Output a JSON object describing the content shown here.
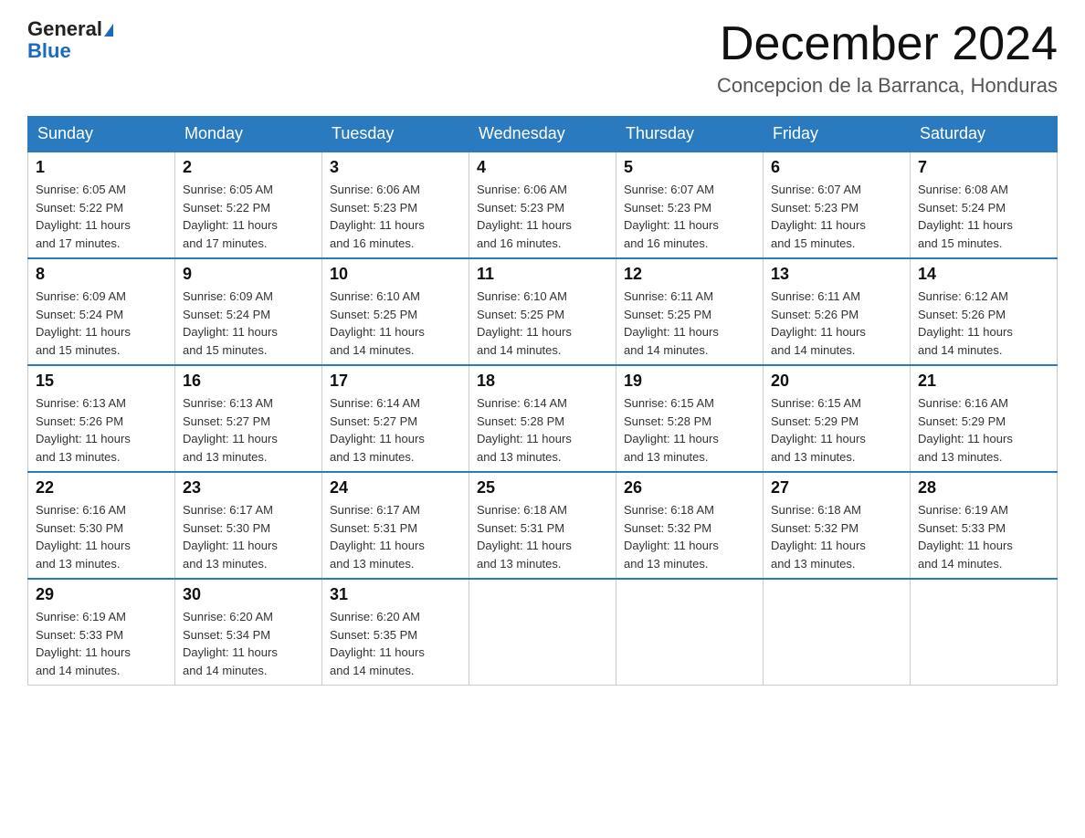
{
  "header": {
    "logo_general": "General",
    "logo_blue": "Blue",
    "month_title": "December 2024",
    "location": "Concepcion de la Barranca, Honduras"
  },
  "days_of_week": [
    "Sunday",
    "Monday",
    "Tuesday",
    "Wednesday",
    "Thursday",
    "Friday",
    "Saturday"
  ],
  "weeks": [
    [
      {
        "day": "1",
        "sunrise": "6:05 AM",
        "sunset": "5:22 PM",
        "daylight": "11 hours and 17 minutes."
      },
      {
        "day": "2",
        "sunrise": "6:05 AM",
        "sunset": "5:22 PM",
        "daylight": "11 hours and 17 minutes."
      },
      {
        "day": "3",
        "sunrise": "6:06 AM",
        "sunset": "5:23 PM",
        "daylight": "11 hours and 16 minutes."
      },
      {
        "day": "4",
        "sunrise": "6:06 AM",
        "sunset": "5:23 PM",
        "daylight": "11 hours and 16 minutes."
      },
      {
        "day": "5",
        "sunrise": "6:07 AM",
        "sunset": "5:23 PM",
        "daylight": "11 hours and 16 minutes."
      },
      {
        "day": "6",
        "sunrise": "6:07 AM",
        "sunset": "5:23 PM",
        "daylight": "11 hours and 15 minutes."
      },
      {
        "day": "7",
        "sunrise": "6:08 AM",
        "sunset": "5:24 PM",
        "daylight": "11 hours and 15 minutes."
      }
    ],
    [
      {
        "day": "8",
        "sunrise": "6:09 AM",
        "sunset": "5:24 PM",
        "daylight": "11 hours and 15 minutes."
      },
      {
        "day": "9",
        "sunrise": "6:09 AM",
        "sunset": "5:24 PM",
        "daylight": "11 hours and 15 minutes."
      },
      {
        "day": "10",
        "sunrise": "6:10 AM",
        "sunset": "5:25 PM",
        "daylight": "11 hours and 14 minutes."
      },
      {
        "day": "11",
        "sunrise": "6:10 AM",
        "sunset": "5:25 PM",
        "daylight": "11 hours and 14 minutes."
      },
      {
        "day": "12",
        "sunrise": "6:11 AM",
        "sunset": "5:25 PM",
        "daylight": "11 hours and 14 minutes."
      },
      {
        "day": "13",
        "sunrise": "6:11 AM",
        "sunset": "5:26 PM",
        "daylight": "11 hours and 14 minutes."
      },
      {
        "day": "14",
        "sunrise": "6:12 AM",
        "sunset": "5:26 PM",
        "daylight": "11 hours and 14 minutes."
      }
    ],
    [
      {
        "day": "15",
        "sunrise": "6:13 AM",
        "sunset": "5:26 PM",
        "daylight": "11 hours and 13 minutes."
      },
      {
        "day": "16",
        "sunrise": "6:13 AM",
        "sunset": "5:27 PM",
        "daylight": "11 hours and 13 minutes."
      },
      {
        "day": "17",
        "sunrise": "6:14 AM",
        "sunset": "5:27 PM",
        "daylight": "11 hours and 13 minutes."
      },
      {
        "day": "18",
        "sunrise": "6:14 AM",
        "sunset": "5:28 PM",
        "daylight": "11 hours and 13 minutes."
      },
      {
        "day": "19",
        "sunrise": "6:15 AM",
        "sunset": "5:28 PM",
        "daylight": "11 hours and 13 minutes."
      },
      {
        "day": "20",
        "sunrise": "6:15 AM",
        "sunset": "5:29 PM",
        "daylight": "11 hours and 13 minutes."
      },
      {
        "day": "21",
        "sunrise": "6:16 AM",
        "sunset": "5:29 PM",
        "daylight": "11 hours and 13 minutes."
      }
    ],
    [
      {
        "day": "22",
        "sunrise": "6:16 AM",
        "sunset": "5:30 PM",
        "daylight": "11 hours and 13 minutes."
      },
      {
        "day": "23",
        "sunrise": "6:17 AM",
        "sunset": "5:30 PM",
        "daylight": "11 hours and 13 minutes."
      },
      {
        "day": "24",
        "sunrise": "6:17 AM",
        "sunset": "5:31 PM",
        "daylight": "11 hours and 13 minutes."
      },
      {
        "day": "25",
        "sunrise": "6:18 AM",
        "sunset": "5:31 PM",
        "daylight": "11 hours and 13 minutes."
      },
      {
        "day": "26",
        "sunrise": "6:18 AM",
        "sunset": "5:32 PM",
        "daylight": "11 hours and 13 minutes."
      },
      {
        "day": "27",
        "sunrise": "6:18 AM",
        "sunset": "5:32 PM",
        "daylight": "11 hours and 13 minutes."
      },
      {
        "day": "28",
        "sunrise": "6:19 AM",
        "sunset": "5:33 PM",
        "daylight": "11 hours and 14 minutes."
      }
    ],
    [
      {
        "day": "29",
        "sunrise": "6:19 AM",
        "sunset": "5:33 PM",
        "daylight": "11 hours and 14 minutes."
      },
      {
        "day": "30",
        "sunrise": "6:20 AM",
        "sunset": "5:34 PM",
        "daylight": "11 hours and 14 minutes."
      },
      {
        "day": "31",
        "sunrise": "6:20 AM",
        "sunset": "5:35 PM",
        "daylight": "11 hours and 14 minutes."
      },
      null,
      null,
      null,
      null
    ]
  ]
}
